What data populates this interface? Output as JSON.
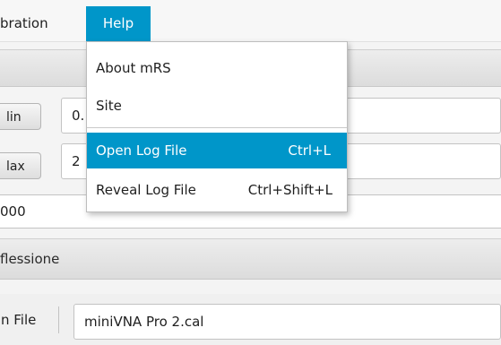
{
  "menubar": {
    "calibration_label": "bration",
    "help_label": "Help"
  },
  "section": {
    "label": "flessione"
  },
  "params": {
    "min_button": "lin",
    "max_button": "lax",
    "min_value": "0.",
    "max_value": "2",
    "steps_value": "000"
  },
  "file": {
    "label": "n File",
    "value": "miniVNA Pro 2.cal"
  },
  "help_menu": {
    "items": [
      {
        "label": "About mRS",
        "accelerator": ""
      },
      {
        "label": "Site",
        "accelerator": ""
      },
      {
        "label": "Open Log File",
        "accelerator": "Ctrl+L"
      },
      {
        "label": "Reveal Log File",
        "accelerator": "Ctrl+Shift+L"
      }
    ]
  },
  "colors": {
    "accent": "#0096c9"
  }
}
